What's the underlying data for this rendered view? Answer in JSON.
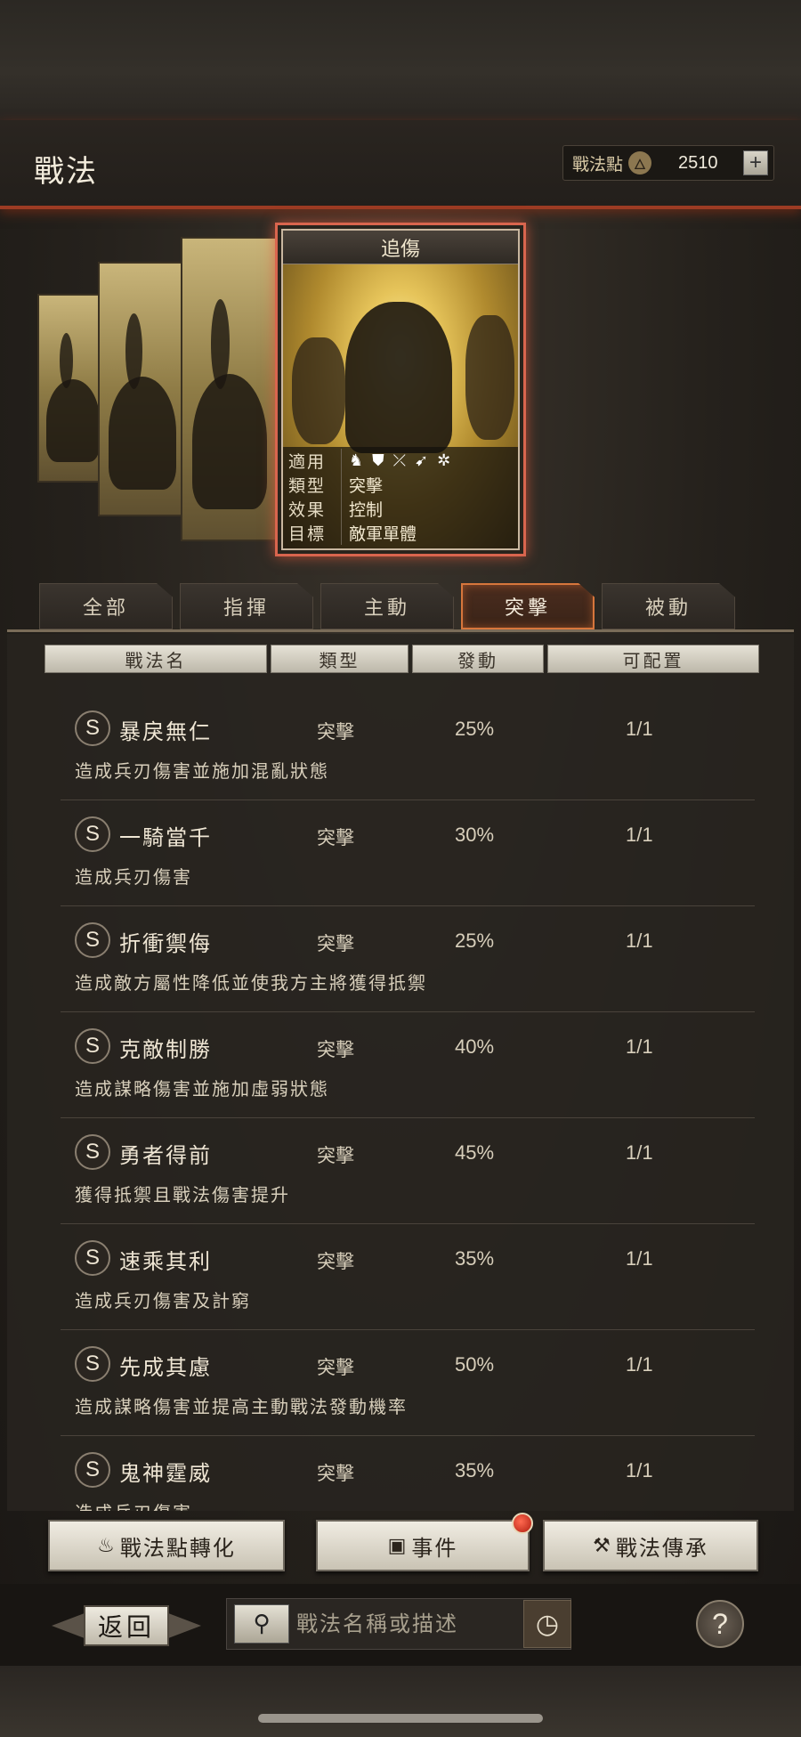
{
  "header": {
    "title": "戰法",
    "points_label": "戰法點",
    "points_value": "2510",
    "plus_label": "+"
  },
  "card": {
    "name": "追傷",
    "rows": [
      {
        "key": "適用",
        "value": ""
      },
      {
        "key": "類型",
        "value": "突擊"
      },
      {
        "key": "效果",
        "value": "控制"
      },
      {
        "key": "目標",
        "value": "敵軍單體"
      }
    ],
    "troop_icons": [
      "cavalry-icon",
      "shield-icon",
      "bow-icon",
      "spear-icon",
      "siege-icon"
    ]
  },
  "tabs": [
    {
      "label": "全部",
      "active": false
    },
    {
      "label": "指揮",
      "active": false
    },
    {
      "label": "主動",
      "active": false
    },
    {
      "label": "突擊",
      "active": true
    },
    {
      "label": "被動",
      "active": false
    }
  ],
  "columns": [
    "戰法名",
    "類型",
    "發動",
    "可配置"
  ],
  "tactics": [
    {
      "grade": "S",
      "name": "暴戾無仁",
      "type": "突擊",
      "rate": "25%",
      "slots": "1/1",
      "desc": "造成兵刃傷害並施加混亂狀態"
    },
    {
      "grade": "S",
      "name": "一騎當千",
      "type": "突擊",
      "rate": "30%",
      "slots": "1/1",
      "desc": "造成兵刃傷害"
    },
    {
      "grade": "S",
      "name": "折衝禦侮",
      "type": "突擊",
      "rate": "25%",
      "slots": "1/1",
      "desc": "造成敵方屬性降低並使我方主將獲得抵禦"
    },
    {
      "grade": "S",
      "name": "克敵制勝",
      "type": "突擊",
      "rate": "40%",
      "slots": "1/1",
      "desc": "造成謀略傷害並施加虛弱狀態"
    },
    {
      "grade": "S",
      "name": "勇者得前",
      "type": "突擊",
      "rate": "45%",
      "slots": "1/1",
      "desc": "獲得抵禦且戰法傷害提升"
    },
    {
      "grade": "S",
      "name": "速乘其利",
      "type": "突擊",
      "rate": "35%",
      "slots": "1/1",
      "desc": "造成兵刃傷害及計窮"
    },
    {
      "grade": "S",
      "name": "先成其慮",
      "type": "突擊",
      "rate": "50%",
      "slots": "1/1",
      "desc": "造成謀略傷害並提高主動戰法發動機率"
    },
    {
      "grade": "S",
      "name": "鬼神霆威",
      "type": "突擊",
      "rate": "35%",
      "slots": "1/1",
      "desc": "造成兵刃傷害"
    }
  ],
  "actions": {
    "convert": "戰法點轉化",
    "events": "事件",
    "inherit": "戰法傳承"
  },
  "footer": {
    "back": "返回",
    "search_placeholder": "戰法名稱或描述"
  }
}
